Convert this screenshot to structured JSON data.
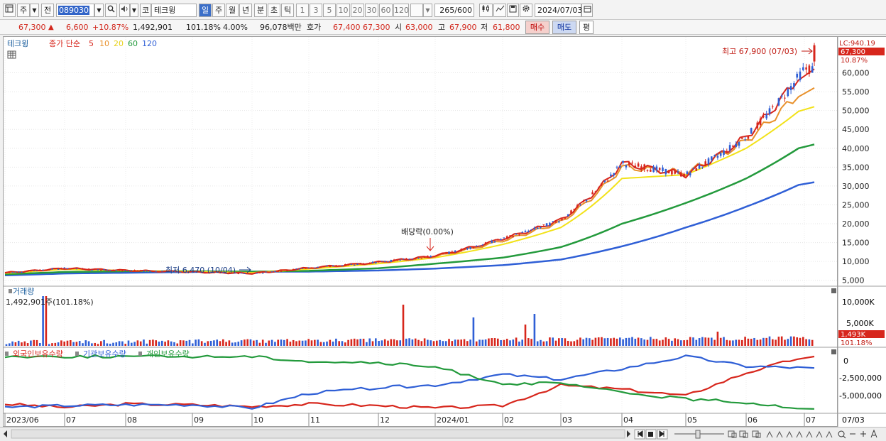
{
  "toolbar": {
    "market": "주",
    "prev_label": "전",
    "stock_code": "089030",
    "stock_name": "테크윙",
    "market_prefix": "코",
    "periods": [
      "일",
      "주",
      "월",
      "년",
      "분",
      "초",
      "틱"
    ],
    "active_period": "일",
    "intervals": [
      "1",
      "3",
      "5",
      "10",
      "20",
      "30",
      "60",
      "120"
    ],
    "count_current": "265",
    "count_total": "/600",
    "date": "2024/07/03"
  },
  "quote": {
    "price": "67,300",
    "change_arrow": "▲",
    "change": "6,600",
    "change_rate": "+10.87%",
    "volume": "1,492,901",
    "volume_ratio": "101.18%",
    "turnover_rate": "4.00%",
    "amount": "96,078백만",
    "bid_label": "호가",
    "bid1": "67,400",
    "bid2": "67,300",
    "open_label": "시",
    "open": "63,000",
    "high_label": "고",
    "high": "67,900",
    "low_label": "저",
    "low": "61,800",
    "buy_button": "매수",
    "sell_button": "매도",
    "eval_button": "평"
  },
  "price_panel": {
    "legend_name": "테크윙",
    "legend_ma": "종가 단순",
    "ma_periods": [
      "5",
      "10",
      "20",
      "60",
      "120"
    ],
    "ma_colors": [
      "#d7261c",
      "#e8902a",
      "#f2e21a",
      "#239a3c",
      "#2f5fd6"
    ],
    "high_annotation": "최고 67,900 (07/03)",
    "low_annotation": "최저 6,470 (10/04)",
    "dividend_annotation": "배당락(0.00%)",
    "lc_label": "LC:940.19",
    "price_tag": "67,300",
    "rate_tag": "10.87%",
    "y_ticks": [
      "60,000",
      "55,000",
      "50,000",
      "45,000",
      "40,000",
      "35,000",
      "30,000",
      "25,000",
      "20,000",
      "15,000",
      "10,000",
      "5,000"
    ]
  },
  "volume_panel": {
    "title": "거래량",
    "value_text": "1,492,901주(101.18%)",
    "y_ticks": [
      "10,000K",
      "5,000K"
    ],
    "volume_tag": "1,493K",
    "ratio_tag": "101.18%"
  },
  "holding_panel": {
    "legend": [
      "외국인보유수량",
      "기관보유수량",
      "개인보유수량"
    ],
    "legend_colors": [
      "#d7261c",
      "#2f5fd6",
      "#239a3c"
    ],
    "y_ticks": [
      "0",
      "-2,500,000",
      "-5,000,000"
    ]
  },
  "x_axis": {
    "labels": [
      "2023/06",
      "07",
      "08",
      "09",
      "10",
      "11",
      "12",
      "2024/01",
      "02",
      "03",
      "04",
      "05",
      "06",
      "07"
    ],
    "right_label": "07/03"
  },
  "chart_data": {
    "type": "line",
    "title": "",
    "x": [
      "2023/06",
      "07",
      "08",
      "09",
      "10",
      "11",
      "12",
      "2024/01",
      "02",
      "03",
      "04",
      "05",
      "06",
      "07"
    ],
    "series": [
      {
        "name": "5",
        "values": [
          7000,
          8200,
          7600,
          7200,
          6800,
          8300,
          9800,
          11500,
          16000,
          21000,
          36000,
          33000,
          43000,
          61000
        ]
      },
      {
        "name": "10",
        "values": [
          7000,
          8100,
          7600,
          7200,
          6900,
          8200,
          9700,
          11300,
          15500,
          20500,
          35000,
          33500,
          42000,
          56000
        ]
      },
      {
        "name": "20",
        "values": [
          6900,
          7900,
          7600,
          7300,
          7000,
          8000,
          9400,
          11000,
          14500,
          19000,
          32000,
          33000,
          40000,
          51000
        ]
      },
      {
        "name": "60",
        "values": [
          6600,
          7200,
          7400,
          7400,
          7300,
          7500,
          8200,
          9400,
          11000,
          13800,
          20000,
          25500,
          32000,
          41000
        ]
      },
      {
        "name": "120",
        "values": [
          6300,
          6800,
          7000,
          7200,
          7300,
          7300,
          7600,
          8100,
          9000,
          10500,
          14000,
          19000,
          24500,
          31000
        ]
      }
    ],
    "ylim": [
      4000,
      68000
    ],
    "high": 67900,
    "low": 6470
  }
}
